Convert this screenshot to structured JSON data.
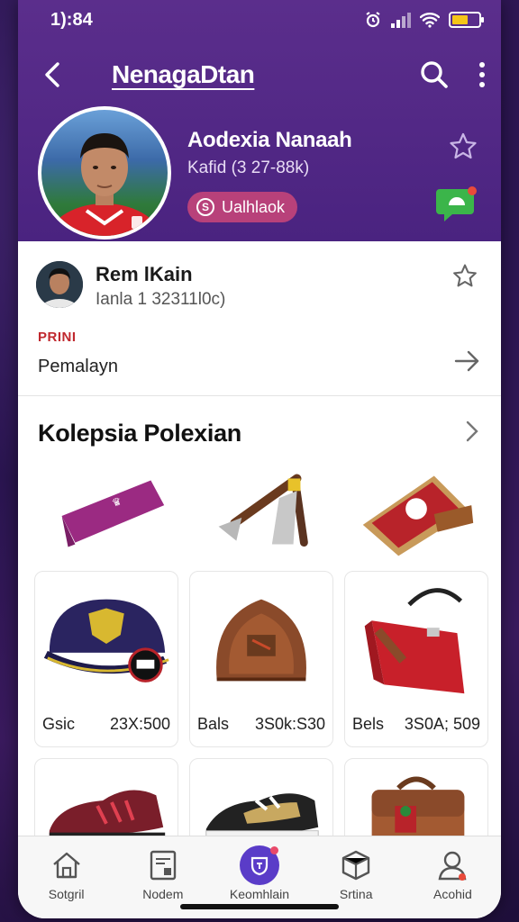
{
  "status_bar": {
    "time": "1):84"
  },
  "app_bar": {
    "title": "NenagaDtan"
  },
  "profile": {
    "name": "Aodexia Nanaah",
    "subtitle": "Kafid (3 27-88k)",
    "badge_label": "Ualhlaok",
    "badge_icon": "S"
  },
  "card": {
    "name": "Rem lKain",
    "subtitle": "Ianla 1 32311l0c)",
    "label": "PRINI",
    "row_text": "Pemalayn"
  },
  "section": {
    "title": "Kolepsia Polexian"
  },
  "products": [
    {
      "label": "",
      "price": ""
    },
    {
      "label": "",
      "price": ""
    },
    {
      "label": "",
      "price": ""
    },
    {
      "label": "Gsic",
      "price": "23X:500"
    },
    {
      "label": "Bals",
      "price": "3S0k:S30"
    },
    {
      "label": "Bels",
      "price": "3S0A; 509"
    },
    {
      "label": "",
      "price": ""
    },
    {
      "label": "",
      "price": ""
    },
    {
      "label": "",
      "price": ""
    }
  ],
  "bottom_nav": [
    {
      "label": "Sotgril",
      "icon": "home-icon"
    },
    {
      "label": "Nodem",
      "icon": "document-icon"
    },
    {
      "label": "Keomhlain",
      "icon": "shield-icon",
      "active": true
    },
    {
      "label": "Srtina",
      "icon": "box-icon"
    },
    {
      "label": "Acohid",
      "icon": "user-icon"
    }
  ],
  "colors": {
    "header": "#5b2e8c",
    "badge": "#b8417a",
    "accent": "#5a3cc8",
    "alert": "#c0282e"
  }
}
